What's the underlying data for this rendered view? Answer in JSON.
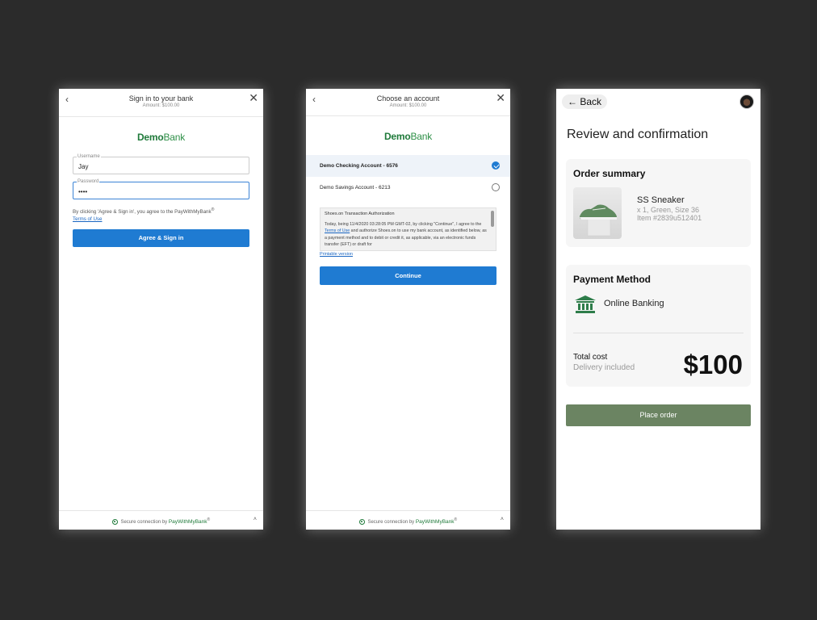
{
  "signin": {
    "title": "Sign in to your bank",
    "amount": "Amount: $100.00",
    "back_glyph": "‹",
    "close_glyph": "✕",
    "logo_part1": "Demo",
    "logo_part2": "Bank",
    "username_label": "Username",
    "username_value": "Jay",
    "password_label": "Password",
    "password_value": "••••",
    "terms_text": "By clicking 'Agree & Sign in', you agree to the PayWithMyBank",
    "terms_reg": "®",
    "terms_link": "Terms of Use",
    "submit_label": "Agree & Sign in"
  },
  "choose": {
    "title": "Choose an account",
    "amount": "Amount: $100.00",
    "back_glyph": "‹",
    "close_glyph": "✕",
    "logo_part1": "Demo",
    "logo_part2": "Bank",
    "accounts": [
      {
        "label": "Demo Checking Account - 6576",
        "selected": true
      },
      {
        "label": "Demo Savings Account - 6213",
        "selected": false
      }
    ],
    "auth_heading": "Shoes.on Transaction Authorization",
    "auth_text_1": "Today, being 11/4/2020 03:28:05 PM GMT-02, by clicking \"Continue\", I agree to the ",
    "auth_link": "Terms of Use",
    "auth_text_2": " and authorize Shoes.on to use my bank account, as identified below, as a payment method and to debit or credit it, as applicable, via an electronic funds transfer (EFT) or draft for",
    "printable": "Printable version",
    "continue_label": "Continue"
  },
  "footer": {
    "prefix": "Secure connection by",
    "brand": "PayWithMyBank",
    "reg": "®",
    "chevron": "˄"
  },
  "review": {
    "back_arrow": "←",
    "back_label": "Back",
    "title": "Review and confirmation",
    "order_heading": "Order summary",
    "product_name": "SS Sneaker",
    "product_meta_1": "x 1, Green, Size 36",
    "product_meta_2": "Item #2839u512401",
    "payment_heading": "Payment Method",
    "payment_method": "Online Banking",
    "total_label": "Total cost",
    "delivery_label": "Delivery included",
    "total_value": "$100",
    "place_order_label": "Place order"
  },
  "colors": {
    "bank_blue": "#1f7bd2",
    "brand_green": "#1f7a3a",
    "place_order": "#6b8462"
  },
  "icons": [
    "back-icon",
    "close-icon",
    "check-icon",
    "shield-icon",
    "bank-icon",
    "avatar",
    "arrow-left-icon",
    "chevron-up-icon"
  ]
}
